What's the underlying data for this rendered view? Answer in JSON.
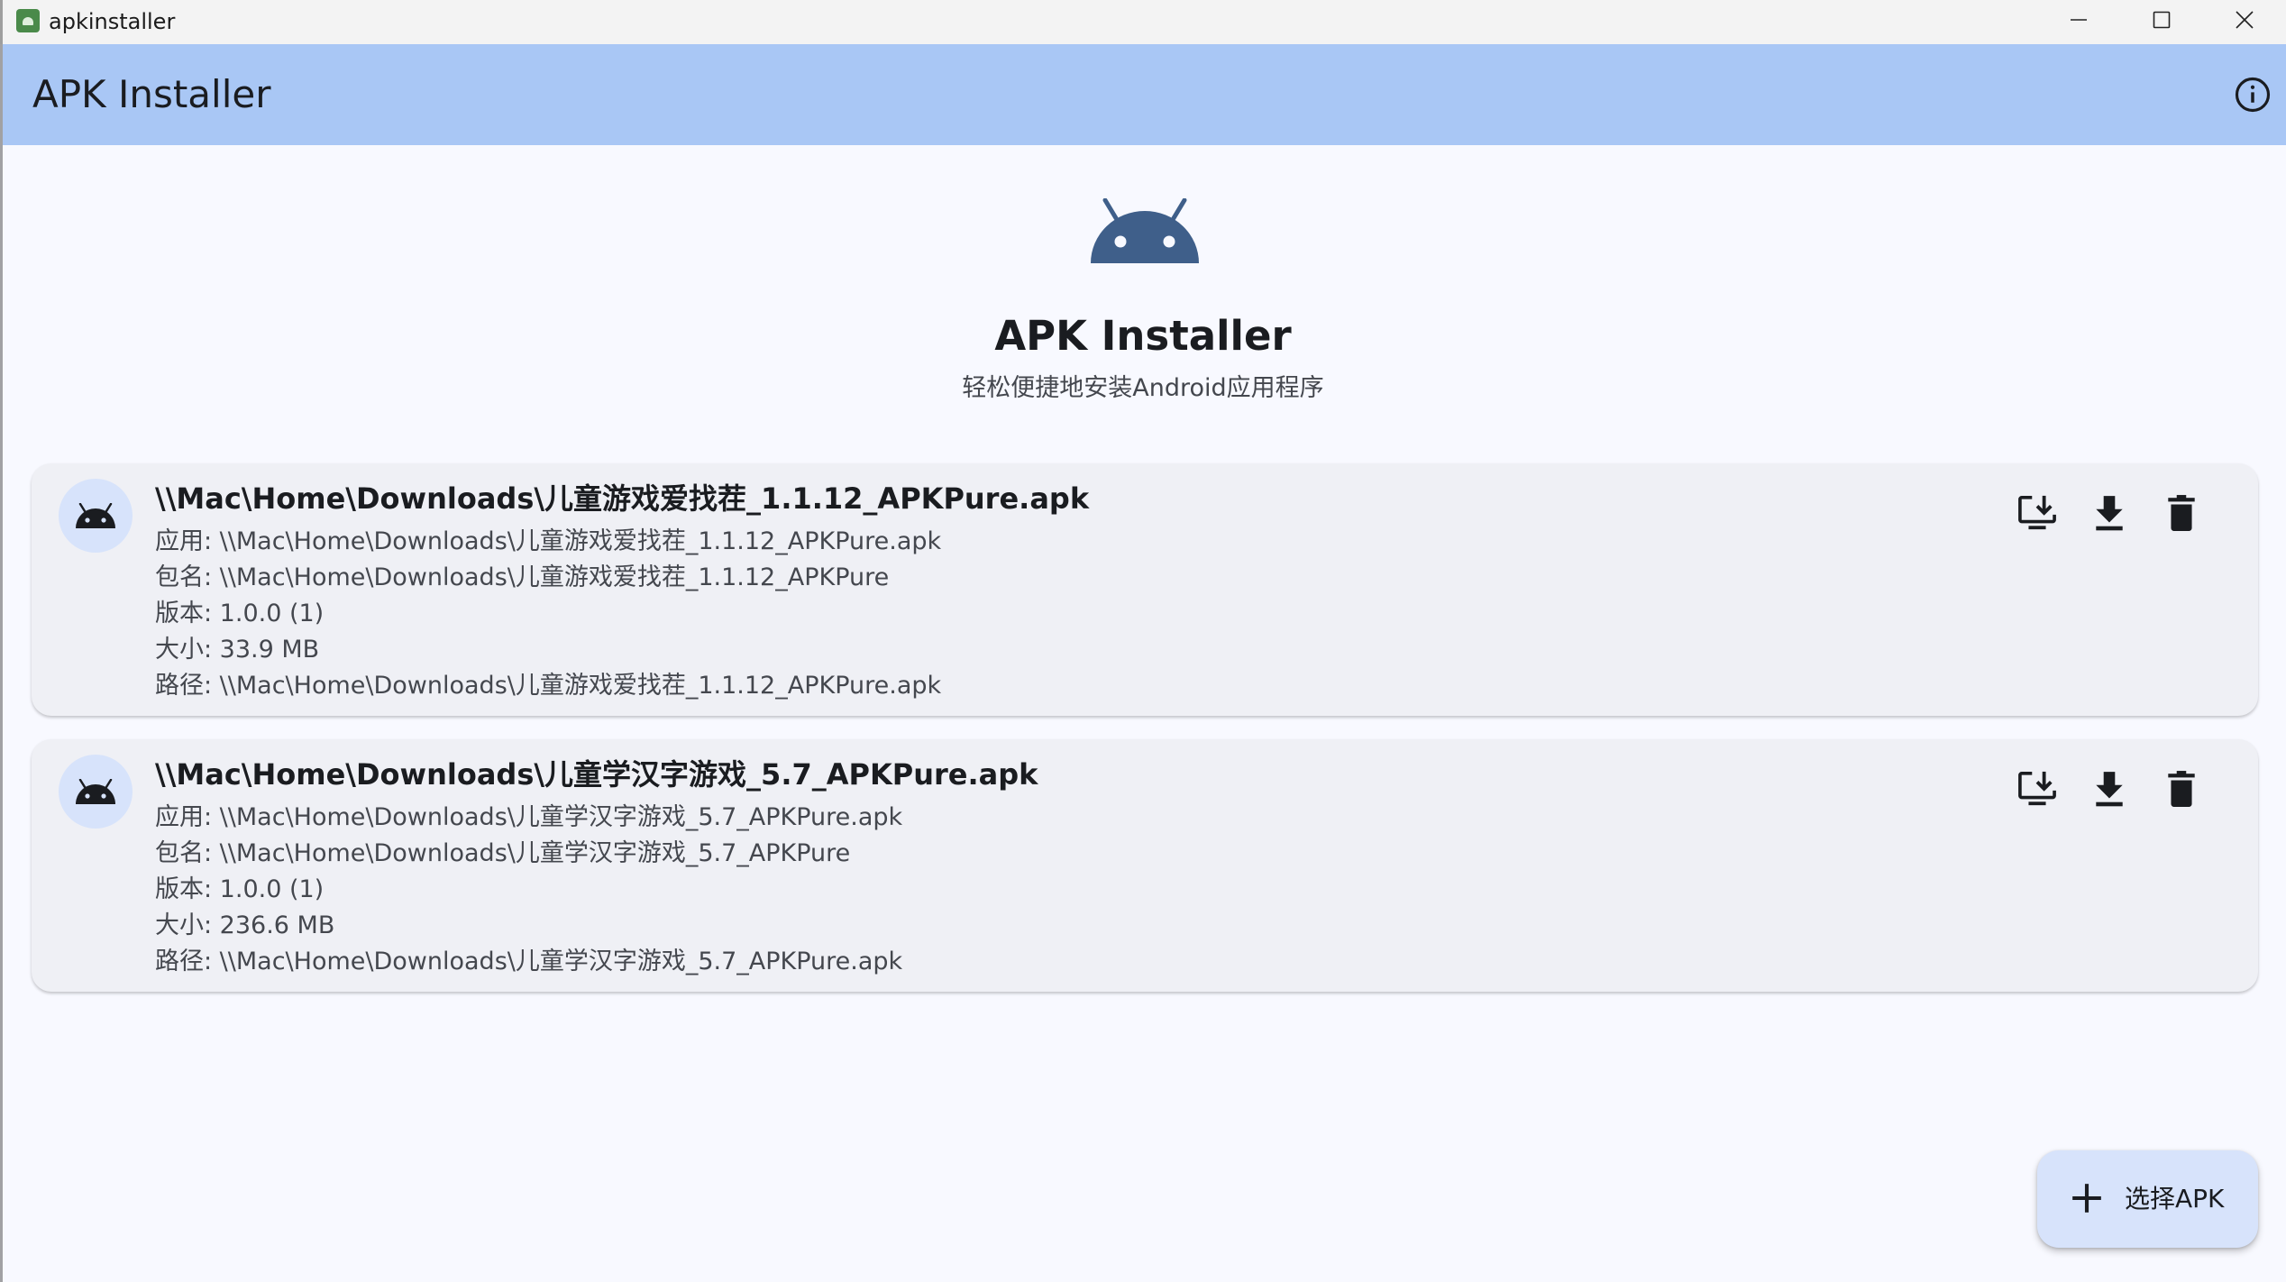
{
  "window": {
    "title": "apkinstaller"
  },
  "appbar": {
    "title": "APK Installer",
    "info_icon": "info-icon"
  },
  "hero": {
    "icon": "android-icon",
    "title": "APK Installer",
    "subtitle": "轻松便捷地安装Android应用程序"
  },
  "files": [
    {
      "title": "\\\\Mac\\Home\\Downloads\\儿童游戏爱找茬_1.1.12_APKPure.apk",
      "app": "应用: \\\\Mac\\Home\\Downloads\\儿童游戏爱找茬_1.1.12_APKPure.apk",
      "package": "包名: \\\\Mac\\Home\\Downloads\\儿童游戏爱找茬_1.1.12_APKPure",
      "version": "版本: 1.0.0 (1)",
      "size": "大小: 33.9 MB",
      "path": "路径: \\\\Mac\\Home\\Downloads\\儿童游戏爱找茬_1.1.12_APKPure.apk"
    },
    {
      "title": "\\\\Mac\\Home\\Downloads\\儿童学汉字游戏_5.7_APKPure.apk",
      "app": "应用: \\\\Mac\\Home\\Downloads\\儿童学汉字游戏_5.7_APKPure.apk",
      "package": "包名: \\\\Mac\\Home\\Downloads\\儿童学汉字游戏_5.7_APKPure",
      "version": "版本: 1.0.0 (1)",
      "size": "大小: 236.6 MB",
      "path": "路径: \\\\Mac\\Home\\Downloads\\儿童学汉字游戏_5.7_APKPure.apk"
    }
  ],
  "fab": {
    "label": "选择APK",
    "icon": "plus-icon"
  },
  "colors": {
    "appbar": "#a9c7f5",
    "background": "#f8f9ff",
    "card": "#eff0f5",
    "android_icon": "#3f5f8a",
    "fab": "#d7e3fb"
  }
}
